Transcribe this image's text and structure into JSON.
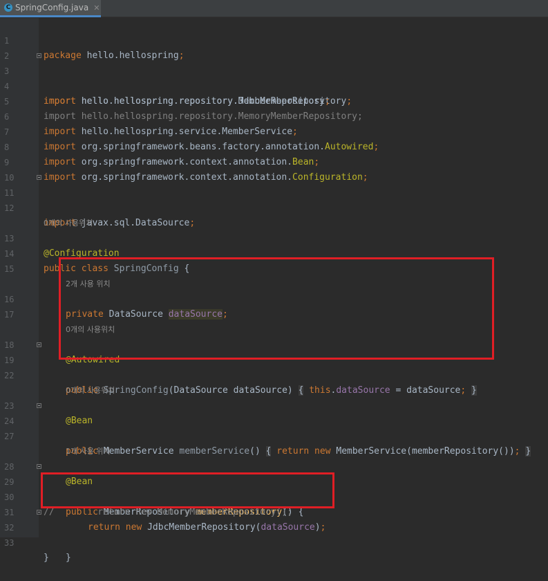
{
  "tab": {
    "filename": "SpringConfig.java",
    "icon_letter": "C",
    "close": "✕"
  },
  "lines": [
    {
      "n": "1",
      "t": "package hello.hellospring;"
    },
    {
      "n": "2"
    },
    {
      "n": "3",
      "t": "import hello.hellospring.repository.JdbcMemberRepository;"
    },
    {
      "n": "4",
      "t": "import hello.hellospring.repository.MemberRepository;"
    },
    {
      "n": "5",
      "t": "import hello.hellospring.repository.MemoryMemberRepository;"
    },
    {
      "n": "6",
      "t": "import hello.hellospring.service.MemberService;"
    },
    {
      "n": "7",
      "t": "import org.springframework.beans.factory.annotation.Autowired;"
    },
    {
      "n": "8",
      "t": "import org.springframework.context.annotation.Bean;"
    },
    {
      "n": "9",
      "t": "import org.springframework.context.annotation.Configuration;"
    },
    {
      "n": "10"
    },
    {
      "n": "11",
      "t": "import javax.sql.DataSource;"
    },
    {
      "n": "12"
    },
    {
      "hint": "0개의 사용위치"
    },
    {
      "n": "13",
      "t": "@Configuration"
    },
    {
      "n": "14",
      "t": "public class SpringConfig {"
    },
    {
      "n": "15"
    },
    {
      "hint": "2개 사용 위치"
    },
    {
      "n": "16",
      "t": "private DataSource dataSource;"
    },
    {
      "n": "17"
    },
    {
      "hint": "0개의 사용위치"
    },
    {
      "n": "18",
      "t": "@Autowired"
    },
    {
      "n": "19",
      "t": "public SpringConfig(DataSource dataSource) { this.dataSource = dataSource; }"
    },
    {
      "n": "22"
    },
    {
      "hint": "0개의 사용위치"
    },
    {
      "n": "23",
      "t": "@Bean"
    },
    {
      "n": "24",
      "t": "public MemberService memberService() { return new MemberService(memberRepository()); }"
    },
    {
      "n": "27"
    },
    {
      "hint": "1개 사용 위치"
    },
    {
      "n": "28",
      "t": "@Bean"
    },
    {
      "n": "29",
      "t": "public MemberRepository memberRepository() {"
    },
    {
      "n": "30",
      "t": "//        return new MemoryMemberRepository();"
    },
    {
      "n": "31",
      "t": "return new JdbcMemberRepository(dataSource);"
    },
    {
      "n": "32",
      "t": "}"
    },
    {
      "n": "33",
      "t": "}"
    }
  ],
  "colors": {
    "background": "#2b2b2b",
    "gutter": "#313335",
    "keyword": "#cc7832",
    "annotation": "#bbb529",
    "field": "#9876aa",
    "method": "#ffc66d",
    "text": "#a9b7c6",
    "highlight_box": "#e01e25"
  }
}
